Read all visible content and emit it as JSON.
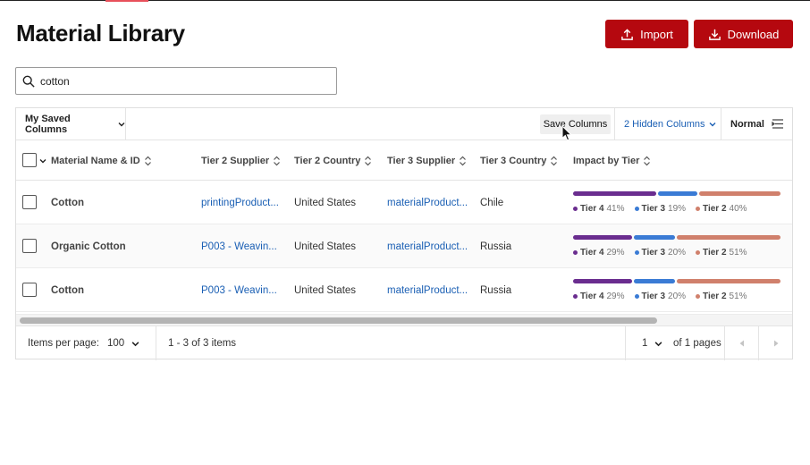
{
  "page": {
    "title": "Material Library",
    "import_label": "Import",
    "download_label": "Download",
    "brand_color": "#b5080f"
  },
  "search": {
    "value": "cotton",
    "icon": "search-icon"
  },
  "toolbar": {
    "saved_columns_label": "My Saved Columns",
    "save_columns_label": "Save Columns",
    "hidden_columns_label": "2 Hidden Columns",
    "density_label": "Normal",
    "density_icon": "density-settings-icon"
  },
  "columns": [
    {
      "key": "name",
      "label": "Material Name & ID"
    },
    {
      "key": "t2_supplier",
      "label": "Tier 2 Supplier"
    },
    {
      "key": "t2_country",
      "label": "Tier 2 Country"
    },
    {
      "key": "t3_supplier",
      "label": "Tier 3 Supplier"
    },
    {
      "key": "t3_country",
      "label": "Tier 3 Country"
    },
    {
      "key": "impact",
      "label": "Impact by Tier"
    }
  ],
  "tier_colors": {
    "tier4": "#6a2d8f",
    "tier3": "#3a7bd5",
    "tier2": "#d0806c"
  },
  "rows": [
    {
      "name": "Cotton",
      "t2_supplier": "printingProduct...",
      "t2_country": "United States",
      "t3_supplier": "materialProduct...",
      "t3_country": "Chile",
      "impact": [
        {
          "tier": "Tier 4",
          "pct_label": "41%",
          "value": 41
        },
        {
          "tier": "Tier 3",
          "pct_label": "19%",
          "value": 19
        },
        {
          "tier": "Tier 2",
          "pct_label": "40%",
          "value": 40
        }
      ]
    },
    {
      "name": "Organic Cotton",
      "t2_supplier": "P003 - Weavin...",
      "t2_country": "United States",
      "t3_supplier": "materialProduct...",
      "t3_country": "Russia",
      "impact": [
        {
          "tier": "Tier 4",
          "pct_label": "29%",
          "value": 29
        },
        {
          "tier": "Tier 3",
          "pct_label": "20%",
          "value": 20
        },
        {
          "tier": "Tier 2",
          "pct_label": "51%",
          "value": 51
        }
      ]
    },
    {
      "name": "Cotton",
      "t2_supplier": "P003 - Weavin...",
      "t2_country": "United States",
      "t3_supplier": "materialProduct...",
      "t3_country": "Russia",
      "impact": [
        {
          "tier": "Tier 4",
          "pct_label": "29%",
          "value": 29
        },
        {
          "tier": "Tier 3",
          "pct_label": "20%",
          "value": 20
        },
        {
          "tier": "Tier 2",
          "pct_label": "51%",
          "value": 51
        }
      ]
    }
  ],
  "footer": {
    "items_per_page_label": "Items per page:",
    "items_per_page_value": "100",
    "range_label": "1 - 3 of 3 items",
    "page_value": "1",
    "of_pages_label": "of 1 pages"
  }
}
